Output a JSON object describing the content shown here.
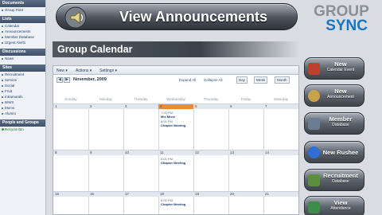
{
  "sidebar": {
    "sections": [
      {
        "title": "Documents",
        "items": [
          "Group Files"
        ]
      },
      {
        "title": "Lists",
        "items": [
          "Calendar",
          "Announcements",
          "Member Database",
          "Urgent Alerts"
        ]
      },
      {
        "title": "Discussions",
        "items": [
          "News"
        ]
      },
      {
        "title": "Sites",
        "items": [
          "Recruitment",
          "Service",
          "Social",
          "Fruit",
          "Intramurals",
          "WWII",
          "Moms",
          "Alumni"
        ]
      },
      {
        "title": "People and Groups",
        "items": [
          "Recycle Bin"
        ]
      }
    ]
  },
  "banner": {
    "title": "View Announcements",
    "icon": "megaphone-icon"
  },
  "logo": {
    "line1": "GROUP",
    "line2": "SYNC"
  },
  "section": {
    "title": "Group Calendar"
  },
  "toolbar": {
    "new": "New ▾",
    "actions": "Actions ▾",
    "settings": "Settings ▾"
  },
  "calendar": {
    "month": "November, 2009",
    "expand_all": "Expand All",
    "collapse_all": "Collapse All",
    "views": [
      "Day",
      "Week",
      "Month"
    ],
    "days_of_week": [
      "Sunday",
      "Monday",
      "Tuesday",
      "Wednesday",
      "Thursday",
      "Friday",
      "Saturday"
    ],
    "weeks": [
      {
        "days": [
          "1",
          "2",
          "3",
          "4",
          "5",
          "6",
          "7"
        ],
        "today_index": 3,
        "events": {
          "3": [
            {
              "time": "7:00 PM",
              "name": "Mix Mixer"
            },
            {
              "time": "8:00 PM",
              "name": "Chapter Meeting"
            }
          ]
        }
      },
      {
        "days": [
          "8",
          "9",
          "10",
          "11",
          "12",
          "13",
          "14"
        ],
        "events": {
          "3": [
            {
              "time": "8:00 PM",
              "name": "Chapter Meeting"
            }
          ]
        }
      },
      {
        "days": [
          "15",
          "16",
          "17",
          "18",
          "19",
          "20",
          "21"
        ],
        "events": {
          "3": [
            {
              "time": "8:00 PM",
              "name": "Chapter Meeting"
            }
          ]
        }
      }
    ]
  },
  "actions": [
    {
      "label": "New",
      "sub": "Calendar Event",
      "icon": "calendar-icon",
      "color": "#c0402e"
    },
    {
      "label": "New",
      "sub": "Announcement",
      "icon": "megaphone-icon",
      "color": "#c7a24a"
    },
    {
      "label": "Member",
      "sub": "Database",
      "icon": "member-icon",
      "color": "#6b7c93"
    },
    {
      "label": "New Rushee",
      "sub": "",
      "icon": "rushee-icon",
      "color": "#2f6fd1"
    },
    {
      "label": "Recruitment",
      "sub": "Database",
      "icon": "recruitment-icon",
      "color": "#5b8f3a"
    },
    {
      "label": "View",
      "sub": "Attendance",
      "icon": "attendance-icon",
      "color": "#3a8e4a"
    }
  ]
}
